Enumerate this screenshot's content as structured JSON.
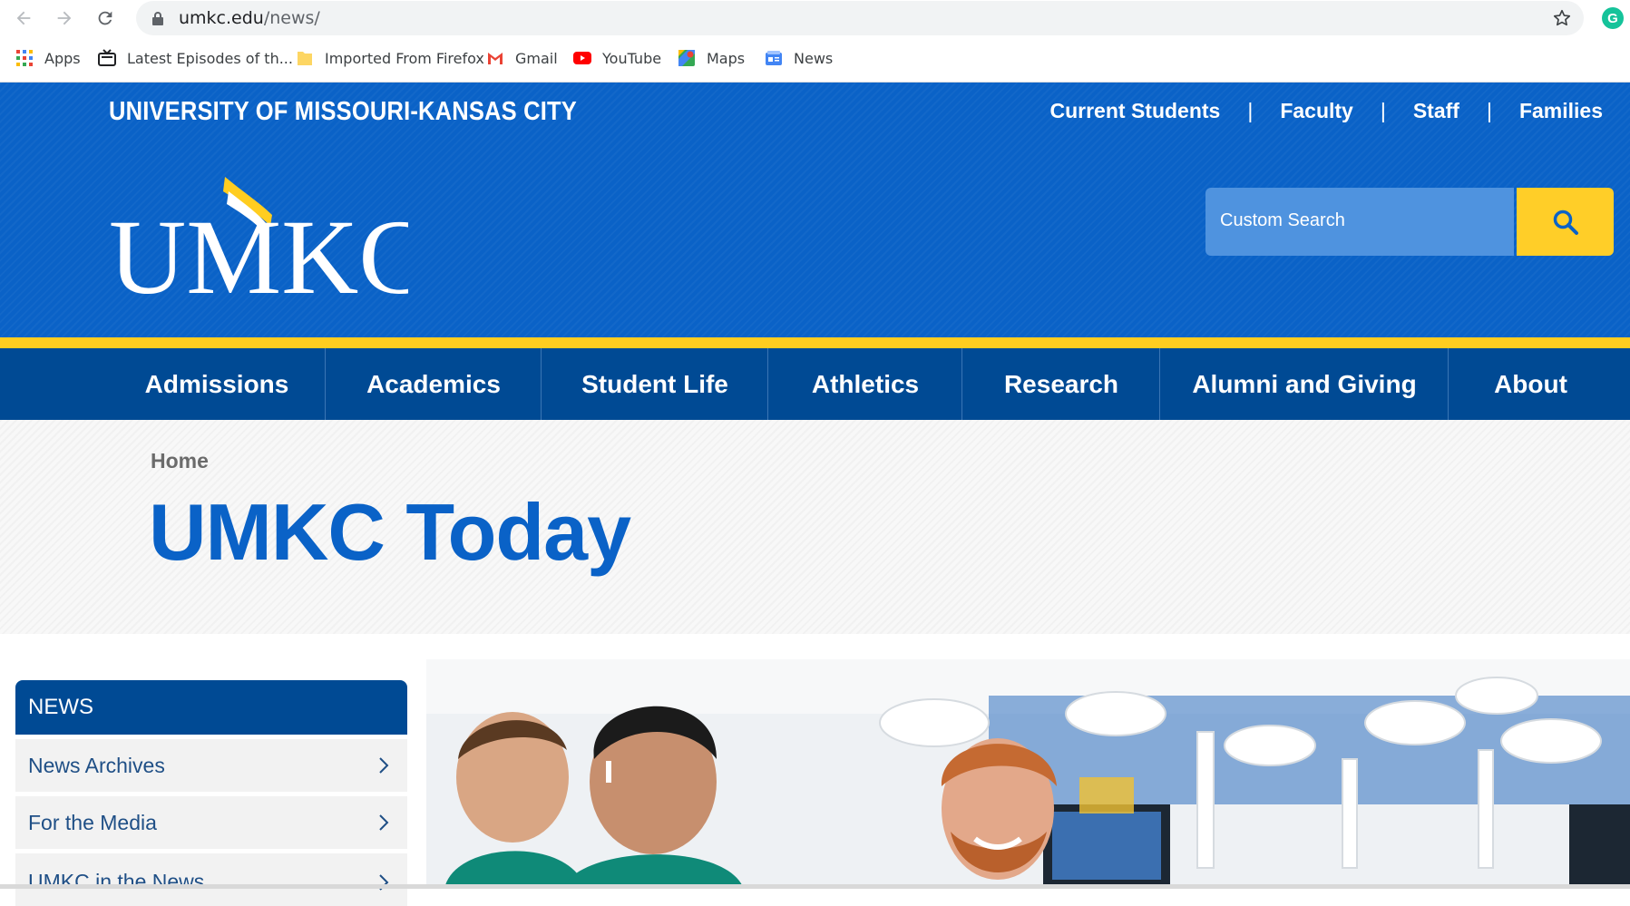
{
  "browser": {
    "url_host": "umkc.edu",
    "url_path": "/news/",
    "extension_label": "G",
    "bookmarks": [
      {
        "label": "Apps",
        "icon": "apps-grid-icon"
      },
      {
        "label": "Latest Episodes of th...",
        "icon": "tv-icon"
      },
      {
        "label": "Imported From Firefox",
        "icon": "folder-icon"
      },
      {
        "label": "Gmail",
        "icon": "gmail-icon"
      },
      {
        "label": "YouTube",
        "icon": "youtube-icon"
      },
      {
        "label": "Maps",
        "icon": "maps-icon"
      },
      {
        "label": "News",
        "icon": "news-icon"
      }
    ]
  },
  "header": {
    "university": "UNIVERSITY OF MISSOURI-KANSAS CITY",
    "audience_links": [
      "Current Students",
      "Faculty",
      "Staff",
      "Families"
    ],
    "audience_separator": "|",
    "logo_text": "UMKC",
    "search_placeholder": "Custom Search"
  },
  "main_nav": [
    "Admissions",
    "Academics",
    "Student Life",
    "Athletics",
    "Research",
    "Alumni and Giving",
    "About"
  ],
  "hero": {
    "breadcrumb": "Home",
    "title": "UMKC Today"
  },
  "side_nav": {
    "heading": "NEWS",
    "items": [
      "News Archives",
      "For the Media",
      "UMKC in the News"
    ]
  },
  "colors": {
    "brand_blue": "#0a62c7",
    "nav_blue": "#004a94",
    "gold": "#ffcd20"
  }
}
